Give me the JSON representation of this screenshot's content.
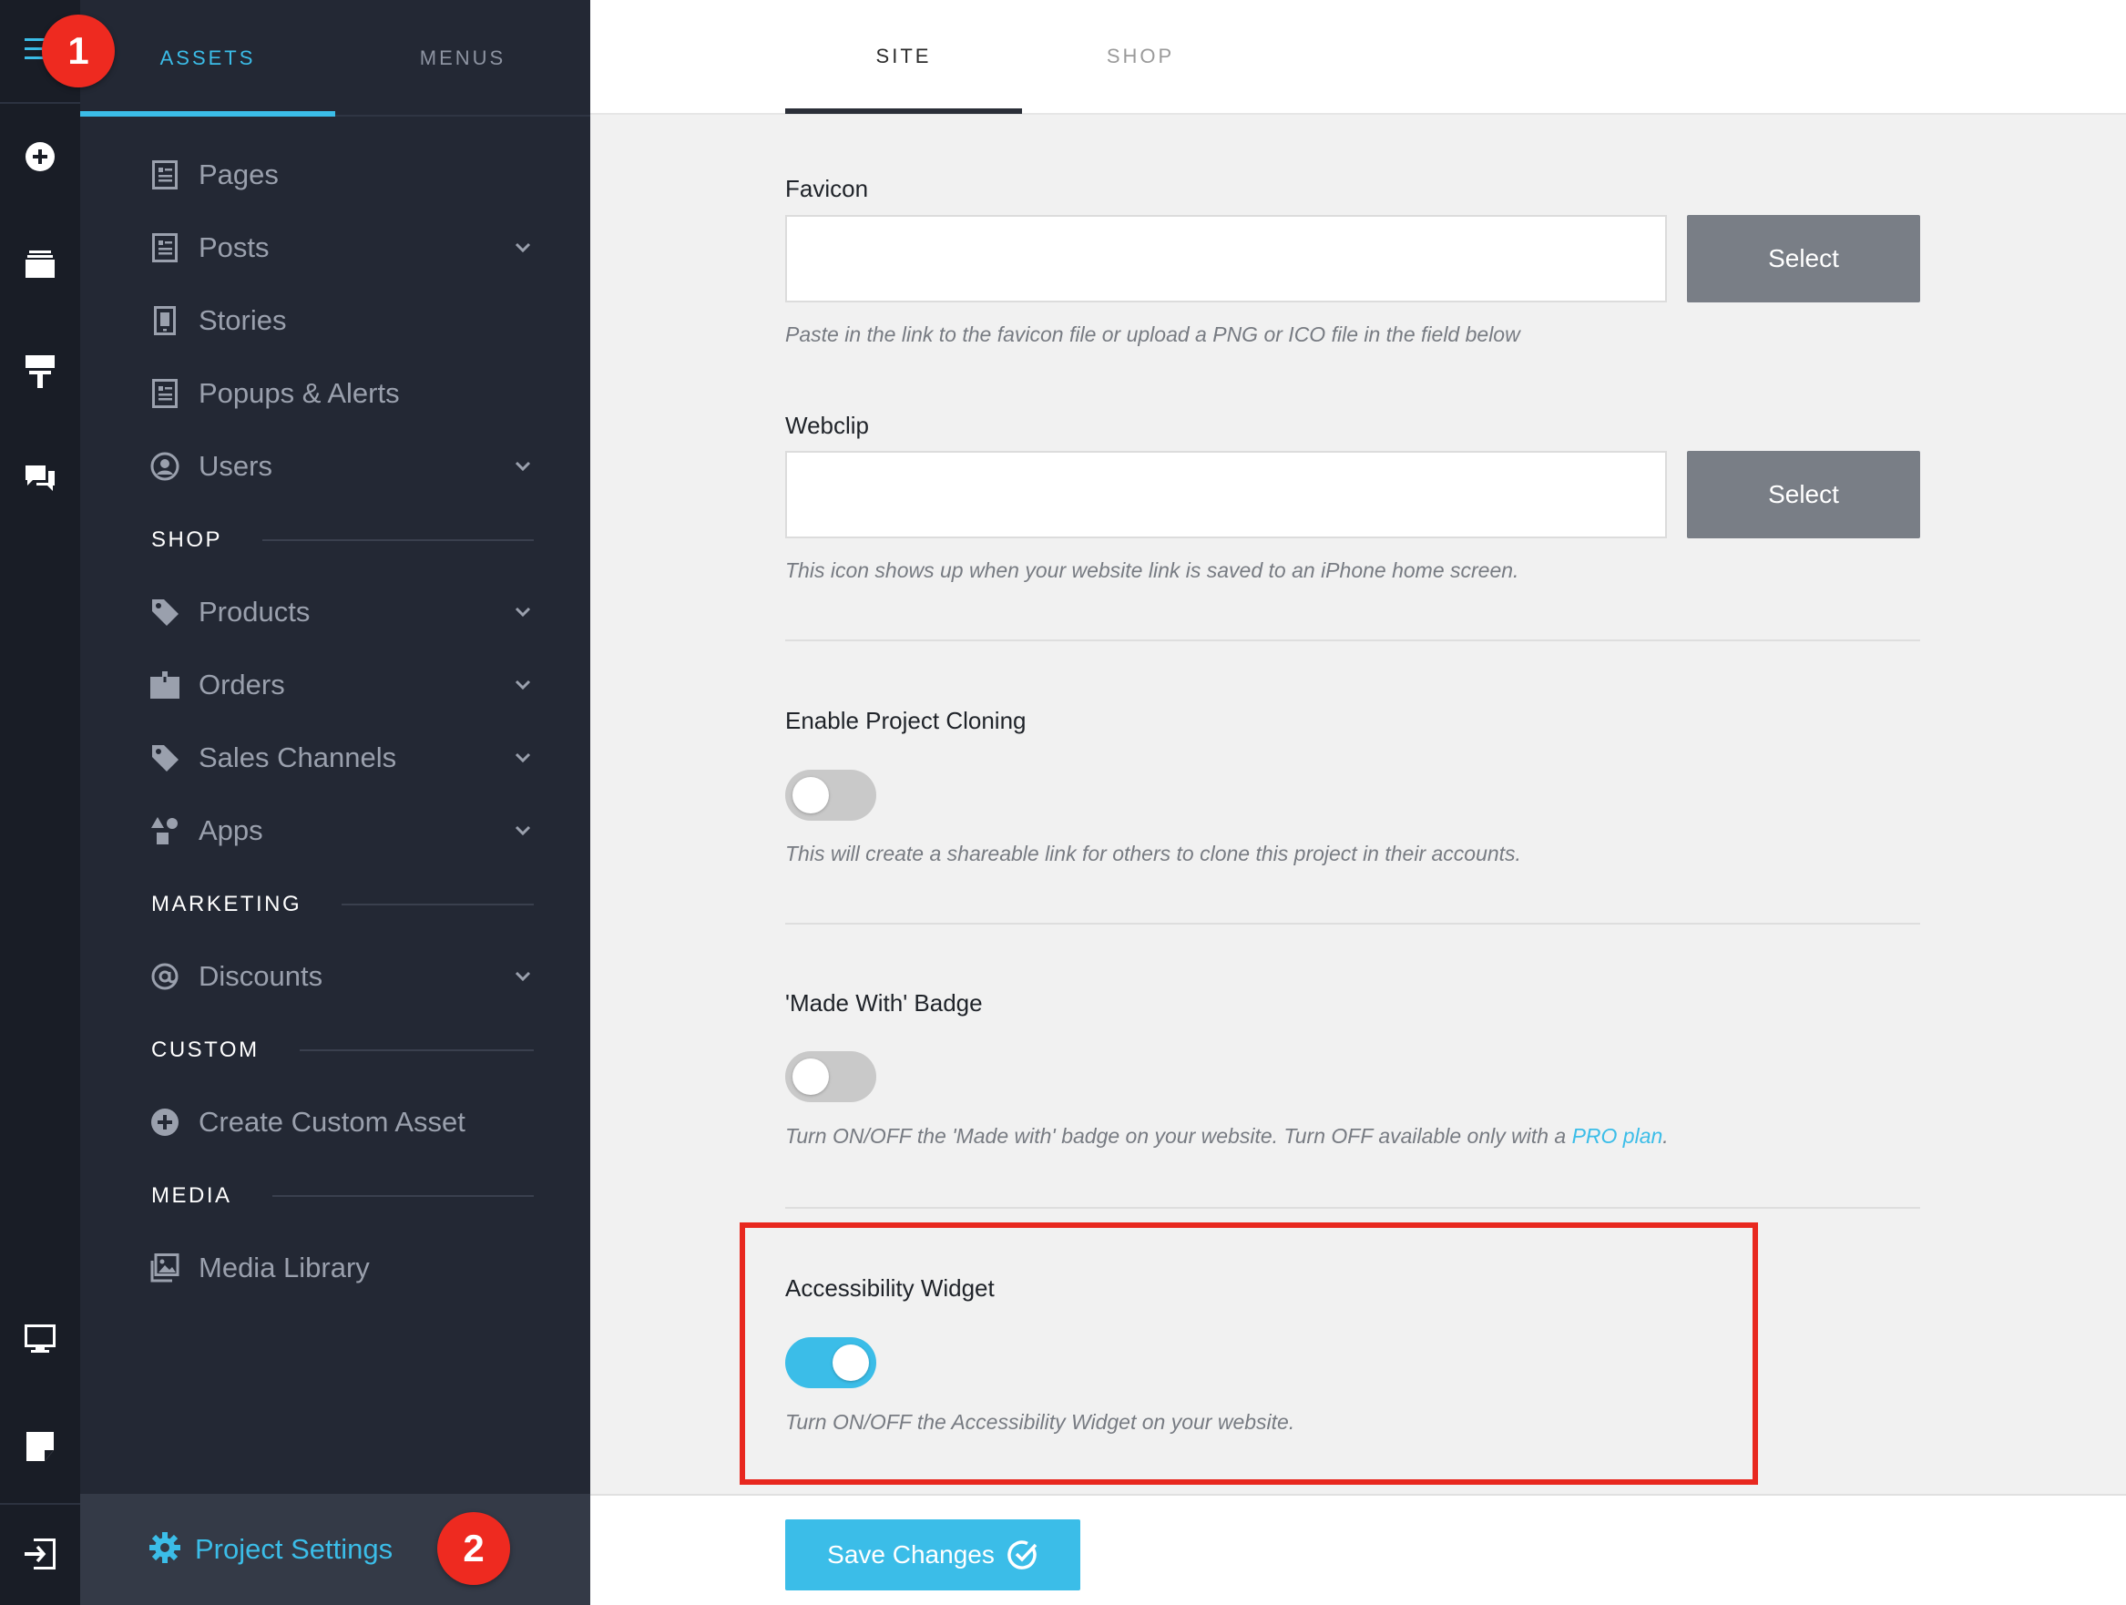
{
  "rail": {
    "icons": [
      "hamburger-menu-icon",
      "add-circle-icon",
      "layers-icon",
      "paint-roller-icon",
      "chat-icon",
      "desktop-icon",
      "note-icon",
      "exit-icon"
    ]
  },
  "sidebar": {
    "tabs": [
      {
        "label": "ASSETS",
        "active": true
      },
      {
        "label": "MENUS",
        "active": false
      }
    ],
    "items": {
      "pages": "Pages",
      "posts": "Posts",
      "stories": "Stories",
      "popups": "Popups & Alerts",
      "users": "Users",
      "products": "Products",
      "orders": "Orders",
      "sales_channels": "Sales Channels",
      "apps": "Apps",
      "discounts": "Discounts",
      "create_custom_asset": "Create Custom Asset",
      "media_library": "Media Library"
    },
    "sections": {
      "shop": "SHOP",
      "marketing": "MARKETING",
      "custom": "CUSTOM",
      "media": "MEDIA"
    },
    "project_settings": "Project Settings"
  },
  "badges": {
    "one": "1",
    "two": "2"
  },
  "main": {
    "tabs": [
      {
        "label": "SITE",
        "active": true
      },
      {
        "label": "SHOP",
        "active": false
      }
    ],
    "favicon": {
      "label": "Favicon",
      "value": "",
      "button": "Select",
      "help": "Paste in the link to the favicon file or upload a PNG or ICO file in the field below"
    },
    "webclip": {
      "label": "Webclip",
      "value": "",
      "button": "Select",
      "help": "This icon shows up when your website link is saved to an iPhone home screen."
    },
    "cloning": {
      "label": "Enable Project Cloning",
      "enabled": false,
      "help": "This will create a shareable link for others to clone this project in their accounts."
    },
    "made_with": {
      "label": "'Made With' Badge",
      "enabled": false,
      "help": "Turn ON/OFF the 'Made with' badge on your website. Turn OFF available only with a ",
      "help_link": "PRO plan",
      "help_end": "."
    },
    "accessibility": {
      "label": "Accessibility Widget",
      "enabled": true,
      "help": "Turn ON/OFF the Accessibility Widget on your website."
    },
    "save_button": "Save Changes"
  },
  "colors": {
    "accent": "#3bbde8",
    "highlight": "#e8281f",
    "badge": "#ee2a20"
  }
}
